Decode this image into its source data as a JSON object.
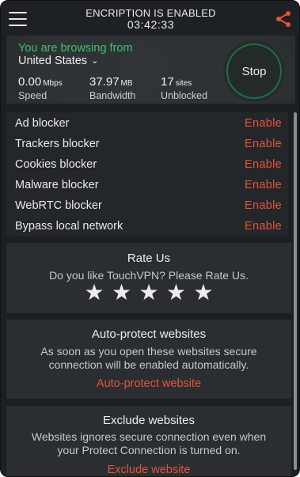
{
  "header": {
    "status_title": "ENCRIPTION IS ENABLED",
    "timer": "03:42:33",
    "menu_icon": "hamburger-menu-icon",
    "share_icon": "share-icon",
    "accent_color": "#e8523a"
  },
  "connection": {
    "browsing_label": "You are browsing from",
    "country": "United States",
    "chevron": "⌄",
    "stats": [
      {
        "value": "0.00",
        "unit": "Mbps",
        "label": "Speed"
      },
      {
        "value": "37.97",
        "unit": "MB",
        "label": "Bandwidth"
      },
      {
        "value": "17",
        "unit": "sites",
        "label": "Unblocked"
      }
    ],
    "stop_label": "Stop",
    "status_color": "#3fbf73"
  },
  "blockers": [
    {
      "name": "Ad blocker",
      "action": "Enable"
    },
    {
      "name": "Trackers blocker",
      "action": "Enable"
    },
    {
      "name": "Cookies blocker",
      "action": "Enable"
    },
    {
      "name": "Malware blocker",
      "action": "Enable"
    },
    {
      "name": "WebRTC blocker",
      "action": "Enable"
    },
    {
      "name": "Bypass local network",
      "action": "Enable"
    }
  ],
  "rate_us": {
    "title": "Rate Us",
    "prompt": "Do you like TouchVPN? Please Rate Us.",
    "stars": [
      "★",
      "★",
      "★",
      "★",
      "★"
    ]
  },
  "auto_protect": {
    "title": "Auto-protect websites",
    "desc_line1": "As soon as you open these websites secure",
    "desc_line2": "connection will be enabled automatically.",
    "link": "Auto-protect website"
  },
  "exclude": {
    "title": "Exclude websites",
    "desc_line1": "Websites ignores secure connection even when",
    "desc_line2": "your Protect Connection is turned on.",
    "link": "Exclude website"
  }
}
